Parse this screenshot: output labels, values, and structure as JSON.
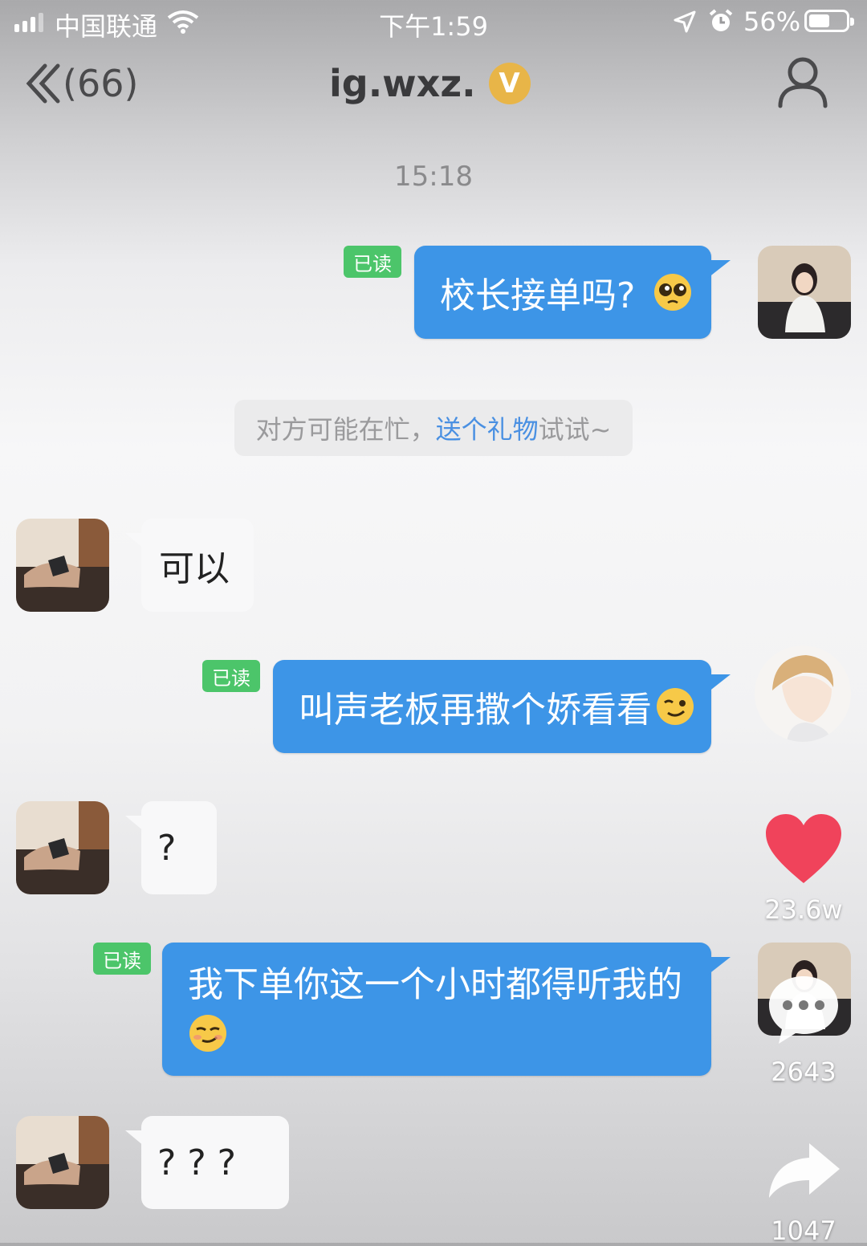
{
  "status_bar": {
    "carrier": "中国联通",
    "time": "下午1:59",
    "battery_percent": "56%",
    "battery_level": 0.56,
    "icons": [
      "signal-icon",
      "wifi-icon",
      "location-icon",
      "alarm-icon",
      "battery-icon"
    ]
  },
  "header": {
    "back_count": "(66)",
    "title": "ig.wxz.",
    "verified_badge": "V",
    "accent": "#e8b548"
  },
  "chat": {
    "timestamp": "15:18",
    "read_label": "已读",
    "notice": {
      "prefix": "对方可能在忙，",
      "link": "送个礼物",
      "suffix": "试试~"
    },
    "messages": [
      {
        "side": "out",
        "text": "校长接单吗?",
        "emoji": "pleading-face-icon",
        "read": true
      },
      {
        "side": "in",
        "text": "可以"
      },
      {
        "side": "out",
        "text": "叫声老板再撒个娇看看",
        "emoji": "wink-face-icon",
        "read": true
      },
      {
        "side": "in",
        "text": "?"
      },
      {
        "side": "out",
        "text": "我下单你这一个小时都得听我的",
        "emoji": "smirk-face-icon",
        "read": true
      },
      {
        "side": "in",
        "text": "? ? ?"
      }
    ],
    "colors": {
      "outgoing": "#3d95e7",
      "read_badge": "#4cc56a",
      "link": "#4a90e2"
    }
  },
  "overlay": {
    "like_count": "23.6w",
    "comment_count": "2643",
    "share_count": "1047",
    "like_color": "#f0435b"
  }
}
